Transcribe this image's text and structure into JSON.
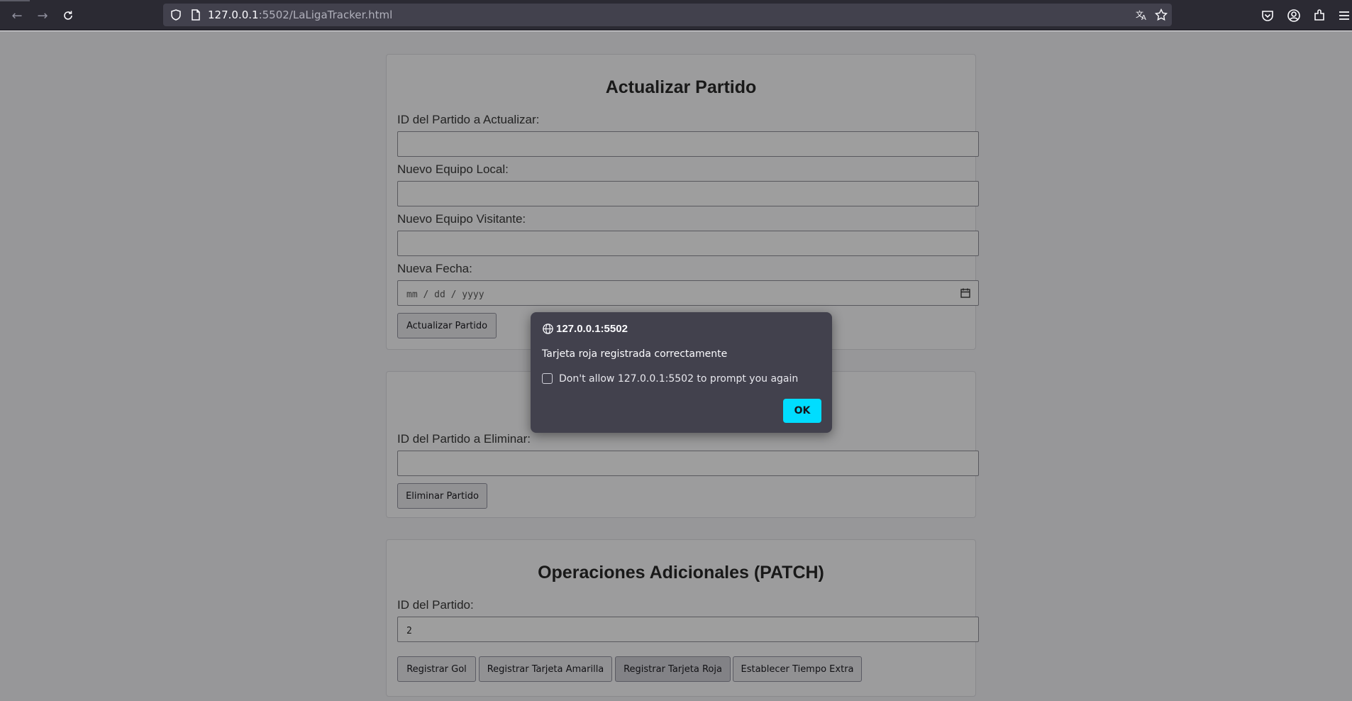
{
  "browser": {
    "url_host": "127.0.0.1",
    "url_rest": ":5502/LaLigaTracker.html"
  },
  "update_section": {
    "title": "Actualizar Partido",
    "id_label": "ID del Partido a Actualizar:",
    "id_value": "",
    "home_label": "Nuevo Equipo Local:",
    "home_value": "",
    "away_label": "Nuevo Equipo Visitante:",
    "away_value": "",
    "date_label": "Nueva Fecha:",
    "date_placeholder": "mm / dd / yyyy",
    "button": "Actualizar Partido"
  },
  "delete_section": {
    "id_label": "ID del Partido a Eliminar:",
    "id_value": "",
    "button": "Eliminar Partido"
  },
  "patch_section": {
    "title": "Operaciones Adicionales (PATCH)",
    "id_label": "ID del Partido:",
    "id_value": "2",
    "buttons": [
      "Registrar Gol",
      "Registrar Tarjeta Amarilla",
      "Registrar Tarjeta Roja",
      "Establecer Tiempo Extra"
    ]
  },
  "dialog": {
    "origin": "127.0.0.1:5502",
    "message": "Tarjeta roja registrada correctamente",
    "checkbox_label": "Don't allow 127.0.0.1:5502 to prompt you again",
    "checkbox_checked": false,
    "ok_label": "OK"
  },
  "colors": {
    "dialog_bg": "#42414d",
    "ok_button": "#00ddff",
    "toolbar_bg": "#2b2a33"
  }
}
